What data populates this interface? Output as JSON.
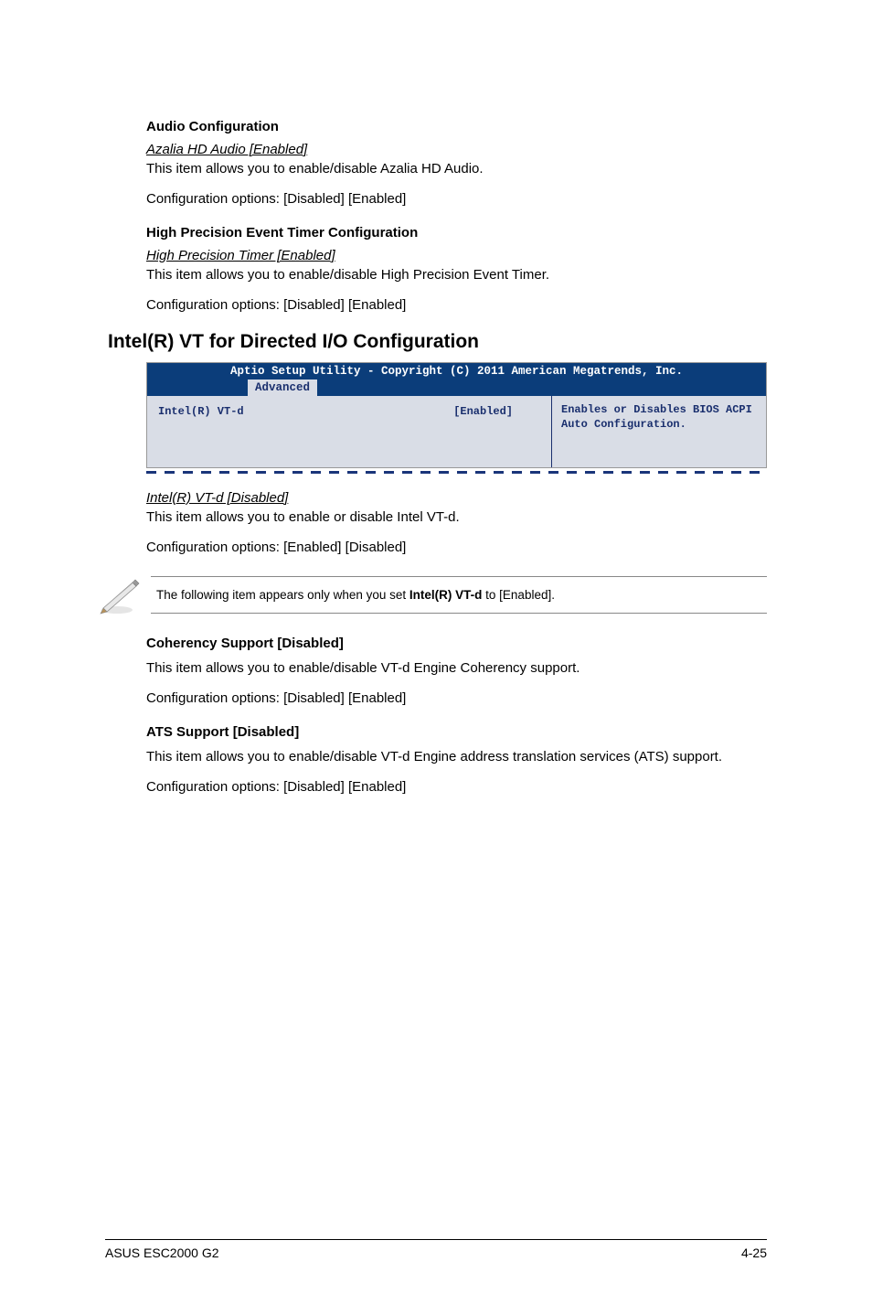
{
  "audio_config": {
    "heading": "Audio Configuration",
    "sub_heading": "Azalia HD Audio [Enabled]",
    "desc": "This item allows you to enable/disable Azalia HD Audio.",
    "options": "Configuration options: [Disabled] [Enabled]"
  },
  "hp_timer": {
    "heading": "High Precision Event Timer Configuration",
    "sub_heading": "High Precision Timer [Enabled]",
    "desc": "This item allows you to enable/disable High Precision Event Timer.",
    "options": "Configuration options: [Disabled] [Enabled]"
  },
  "main_heading": "Intel(R) VT for Directed I/O Configuration",
  "bios": {
    "header": "Aptio Setup Utility - Copyright (C) 2011 American Megatrends, Inc.",
    "tab": "Advanced",
    "item_label": "Intel(R) VT-d",
    "item_value": "[Enabled]",
    "help": "Enables or Disables BIOS ACPI Auto Configuration."
  },
  "vtd": {
    "sub_heading": "Intel(R) VT-d [Disabled]",
    "desc": "This item allows you to enable or disable Intel VT-d.",
    "options": "Configuration options: [Enabled] [Disabled]"
  },
  "note": {
    "prefix": "The following item appears only when you set ",
    "bold": "Intel(R) VT-d",
    "suffix": " to [Enabled]."
  },
  "coherency": {
    "heading": "Coherency Support [Disabled]",
    "desc": "This item allows you to enable/disable VT-d Engine Coherency support.",
    "options": "Configuration options: [Disabled] [Enabled]"
  },
  "ats": {
    "heading": "ATS Support [Disabled]",
    "desc": "This item allows you to enable/disable VT-d Engine address translation services (ATS) support.",
    "options": "Configuration options: [Disabled] [Enabled]"
  },
  "footer": {
    "left": "ASUS ESC2000 G2",
    "right": "4-25"
  }
}
